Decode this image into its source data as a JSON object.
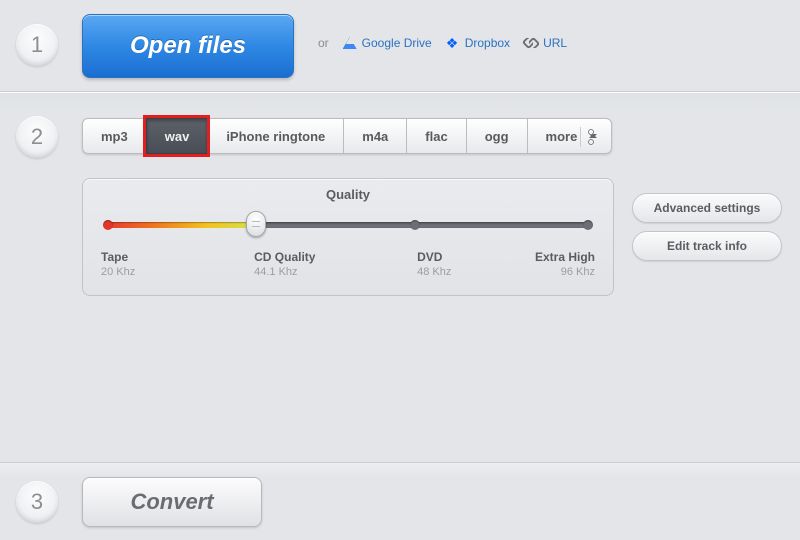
{
  "step_numbers": [
    "1",
    "2",
    "3"
  ],
  "step1": {
    "open_btn": "Open files",
    "or": "or",
    "sources": {
      "drive": "Google Drive",
      "dropbox": "Dropbox",
      "url": "URL"
    }
  },
  "step2": {
    "formats": {
      "mp3": "mp3",
      "wav": "wav",
      "iphone": "iPhone ringtone",
      "m4a": "m4a",
      "flac": "flac",
      "ogg": "ogg",
      "more": "more"
    },
    "selected_format": "wav",
    "quality": {
      "title": "Quality",
      "stops": [
        {
          "name": "Tape",
          "freq": "20 Khz",
          "pos_pct": 0
        },
        {
          "name": "CD Quality",
          "freq": "44.1 Khz",
          "pos_pct": 31
        },
        {
          "name": "DVD",
          "freq": "48 Khz",
          "pos_pct": 64
        },
        {
          "name": "Extra High",
          "freq": "96 Khz",
          "pos_pct": 100
        }
      ],
      "value_pct": 31
    },
    "advanced_btn": "Advanced settings",
    "edit_btn": "Edit track info"
  },
  "step3": {
    "convert_btn": "Convert"
  }
}
